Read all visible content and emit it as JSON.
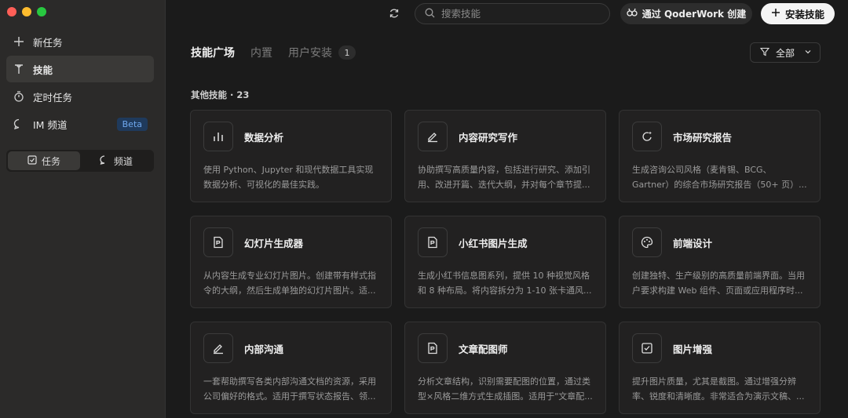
{
  "sidebar": {
    "window_controls": {
      "close_color": "#ff5f57",
      "minimize_color": "#febc2e",
      "zoom_color": "#28c840"
    },
    "items": [
      {
        "label": "新任务",
        "icon": "plus-icon"
      },
      {
        "label": "技能",
        "icon": "skill-icon",
        "active": true
      },
      {
        "label": "定时任务",
        "icon": "timer-icon"
      },
      {
        "label": "IM 频道",
        "icon": "chat-icon",
        "badge": "Beta"
      }
    ],
    "segment": {
      "tasks": "任务",
      "channels": "频道"
    }
  },
  "topbar": {
    "search_placeholder": "搜索技能",
    "create_label": "通过 QoderWork 创建",
    "install_label": "安装技能"
  },
  "tabs": {
    "market": "技能广场",
    "builtin": "内置",
    "user_installed": "用户安装",
    "user_installed_count": "1"
  },
  "filter": {
    "label": "全部"
  },
  "section": {
    "title": "其他技能 · 23"
  },
  "cards": [
    {
      "title": "数据分析",
      "icon": "bar-chart-icon",
      "desc": "使用 Python、Jupyter 和现代数据工具实现数据分析、可视化的最佳实践。"
    },
    {
      "title": "内容研究写作",
      "icon": "pen-icon",
      "desc": "协助撰写高质量内容，包括进行研究、添加引用、改进开篇、迭代大纲，并对每个章节提..."
    },
    {
      "title": "市场研究报告",
      "icon": "sparkle-refresh-icon",
      "desc": "生成咨询公司风格（麦肯锡、BCG、Gartner）的综合市场研究报告（50+ 页）..."
    },
    {
      "title": "幻灯片生成器",
      "icon": "document-icon",
      "desc": "从内容生成专业幻灯片图片。创建带有样式指令的大纲，然后生成单独的幻灯片图片。适..."
    },
    {
      "title": "小红书图片生成",
      "icon": "document-icon",
      "desc": "生成小红书信息图系列，提供 10 种视觉风格和 8 种布局。将内容拆分为 1-10 张卡通风..."
    },
    {
      "title": "前端设计",
      "icon": "palette-icon",
      "desc": "创建独特、生产级别的高质量前端界面。当用户要求构建 Web 组件、页面或应用程序时..."
    },
    {
      "title": "内部沟通",
      "icon": "pen-icon",
      "desc": "一套帮助撰写各类内部沟通文档的资源，采用公司偏好的格式。适用于撰写状态报告、领..."
    },
    {
      "title": "文章配图师",
      "icon": "document-icon",
      "desc": "分析文章结构，识别需要配图的位置，通过类型×风格二维方式生成插图。适用于\"文章配..."
    },
    {
      "title": "图片增强",
      "icon": "checkbox-icon",
      "desc": "提升图片质量，尤其是截图。通过增强分辨率、锐度和清晰度。非常适合为演示文稿、..."
    }
  ]
}
